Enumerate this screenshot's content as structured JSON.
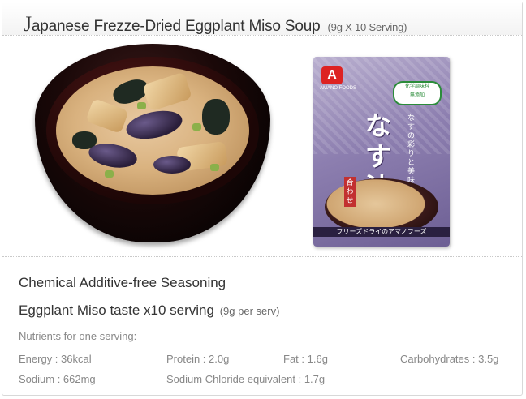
{
  "title": {
    "cap_letter": "J",
    "main": "apanese Frezze-Dried Eggplant Miso Soup",
    "sub": "(9g X 10 Serving)"
  },
  "images": {
    "bowl": "miso-soup-bowl",
    "package": "eggplant-miso-soup-package"
  },
  "package": {
    "logo": "A",
    "brand": "AMANO FOODS",
    "badge_line1": "化学調味料",
    "badge_line2": "無添加",
    "name_kanji": "なす汁",
    "awase": "合わせ",
    "tagline": "なすの彩りと美味しさ",
    "strip": "フリーズドライのアマノフーズ"
  },
  "info": {
    "line1": "Chemical Additive-free Seasoning",
    "line2_main": "Eggplant Miso taste x10 serving",
    "line2_small": "(9g per serv)",
    "nutrients_heading": "Nutrients for one serving:",
    "energy": "Energy : 36kcal",
    "protein": "Protein : 2.0g",
    "fat": "Fat : 1.6g",
    "carbs": "Carbohydrates : 3.5g",
    "sodium": "Sodium : 662mg",
    "sodium_chloride": "Sodium Chloride equivalent : 1.7g"
  }
}
